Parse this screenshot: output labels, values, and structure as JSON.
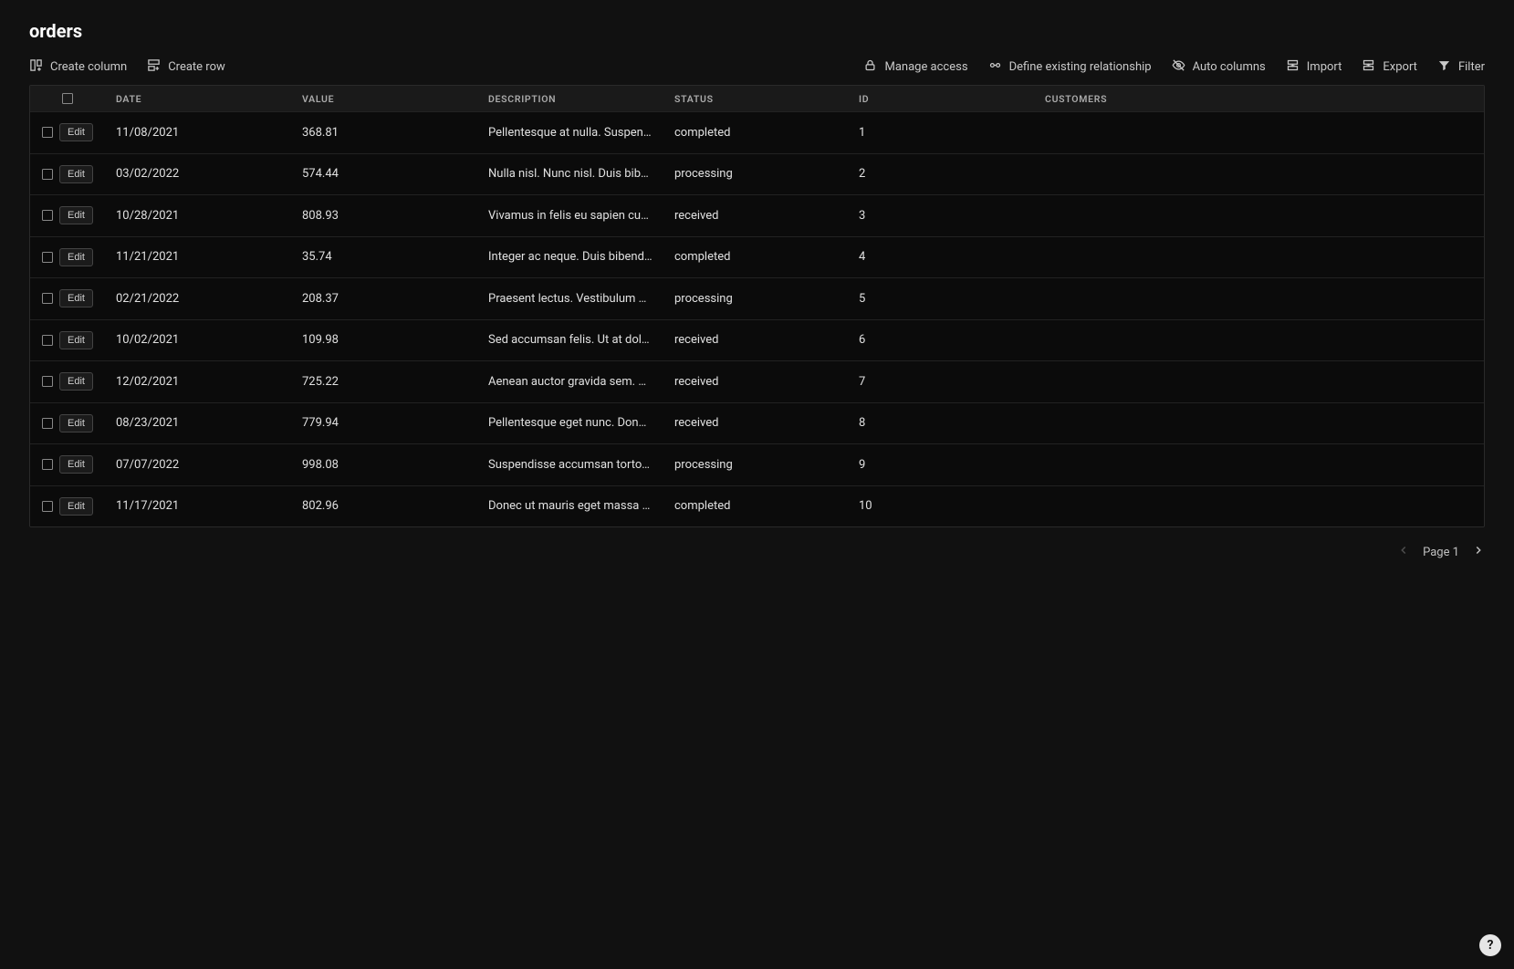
{
  "title": "orders",
  "toolbar": {
    "left": [
      {
        "label": "Create column"
      },
      {
        "label": "Create row"
      }
    ],
    "right": [
      {
        "label": "Manage access"
      },
      {
        "label": "Define existing relationship"
      },
      {
        "label": "Auto columns"
      },
      {
        "label": "Import"
      },
      {
        "label": "Export"
      },
      {
        "label": "Filter"
      }
    ]
  },
  "columns": [
    "DATE",
    "VALUE",
    "DESCRIPTION",
    "STATUS",
    "ID",
    "CUSTOMERS"
  ],
  "edit_label": "Edit",
  "rows": [
    {
      "date": "11/08/2021",
      "value": "368.81",
      "description": "Pellentesque at nulla. Suspendi…",
      "status": "completed",
      "id": "1",
      "customers": ""
    },
    {
      "date": "03/02/2022",
      "value": "574.44",
      "description": "Nulla nisl. Nunc nisl. Duis biben…",
      "status": "processing",
      "id": "2",
      "customers": ""
    },
    {
      "date": "10/28/2021",
      "value": "808.93",
      "description": "Vivamus in felis eu sapien cursu…",
      "status": "received",
      "id": "3",
      "customers": ""
    },
    {
      "date": "11/21/2021",
      "value": "35.74",
      "description": "Integer ac neque. Duis bibendu…",
      "status": "completed",
      "id": "4",
      "customers": ""
    },
    {
      "date": "02/21/2022",
      "value": "208.37",
      "description": "Praesent lectus. Vestibulum qu…",
      "status": "processing",
      "id": "5",
      "customers": ""
    },
    {
      "date": "10/02/2021",
      "value": "109.98",
      "description": "Sed accumsan felis. Ut at dolor …",
      "status": "received",
      "id": "6",
      "customers": ""
    },
    {
      "date": "12/02/2021",
      "value": "725.22",
      "description": "Aenean auctor gravida sem. Pra…",
      "status": "received",
      "id": "7",
      "customers": ""
    },
    {
      "date": "08/23/2021",
      "value": "779.94",
      "description": "Pellentesque eget nunc. Donec …",
      "status": "received",
      "id": "8",
      "customers": ""
    },
    {
      "date": "07/07/2022",
      "value": "998.08",
      "description": "Suspendisse accumsan tortor q…",
      "status": "processing",
      "id": "9",
      "customers": ""
    },
    {
      "date": "11/17/2021",
      "value": "802.96",
      "description": "Donec ut mauris eget massa te…",
      "status": "completed",
      "id": "10",
      "customers": ""
    }
  ],
  "pager": {
    "label": "Page 1"
  },
  "help": "?"
}
